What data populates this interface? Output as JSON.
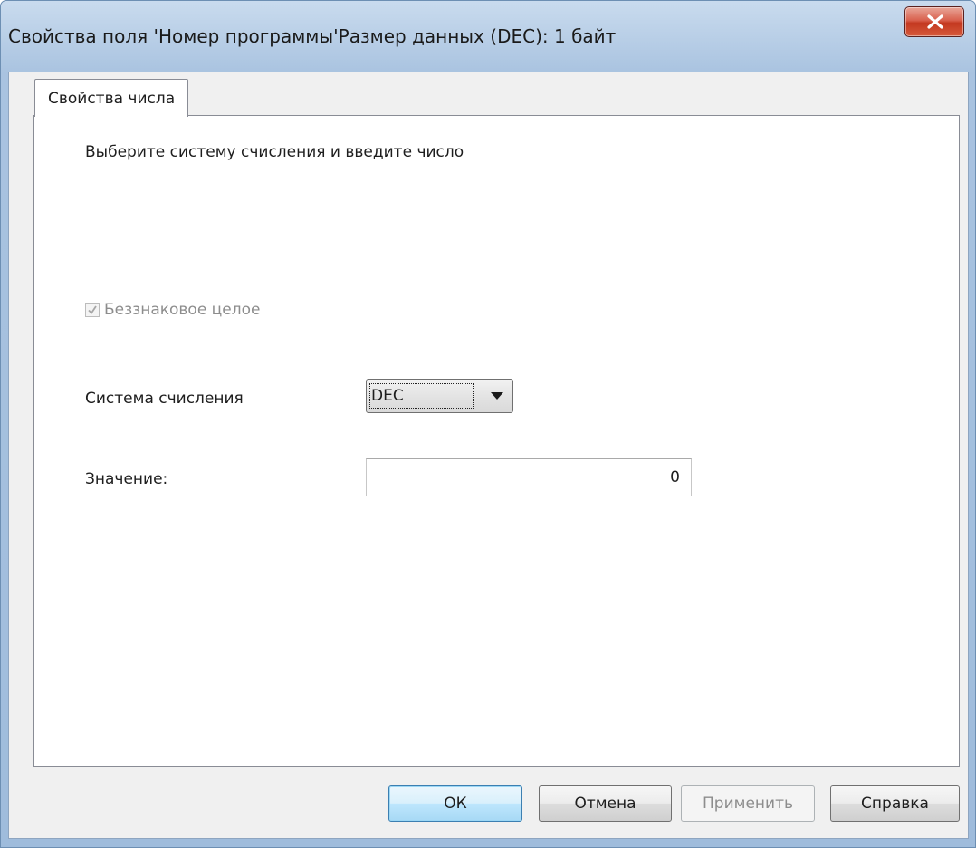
{
  "window": {
    "title": "Свойства поля 'Номер программы'Размер данных (DEC): 1 байт",
    "close_icon": "close-icon"
  },
  "tabs": [
    {
      "label": "Свойства числа",
      "active": true
    }
  ],
  "panel": {
    "instruction": "Выберите систему счисления и введите число",
    "unsigned_checkbox": {
      "label": "Беззнаковое целое",
      "checked": true,
      "disabled": true
    },
    "radix": {
      "label": "Система счисления",
      "selected": "DEC"
    },
    "value": {
      "label": "Значение:",
      "current": "0"
    }
  },
  "buttons": {
    "ok": "ОК",
    "cancel": "Отмена",
    "apply": "Применить",
    "help": "Справка"
  },
  "colors": {
    "window_frame": "#b9cfe7",
    "close_button": "#c9452c",
    "dialog_background": "#f0f0f0",
    "default_button": "#bee6fd"
  }
}
